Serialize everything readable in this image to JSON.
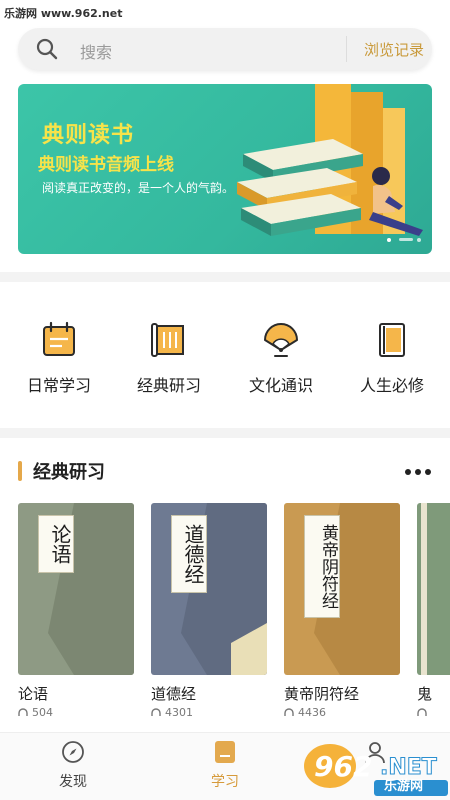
{
  "watermark_top": "乐游网 www.962.net",
  "search": {
    "placeholder": "搜索",
    "history_label": "浏览记录"
  },
  "banner": {
    "title": "典则读书",
    "subtitle": "典则读书音频上线",
    "description": "阅读真正改变的，是一个人的气韵。"
  },
  "categories": [
    {
      "label": "日常学习",
      "icon": "calendar-icon"
    },
    {
      "label": "经典研习",
      "icon": "scroll-icon"
    },
    {
      "label": "文化通识",
      "icon": "fan-icon"
    },
    {
      "label": "人生必修",
      "icon": "book-icon"
    }
  ],
  "section": {
    "title": "经典研习",
    "more_icon": "more-icon"
  },
  "books": [
    {
      "name": "论语",
      "listens": "504",
      "cover_title": "论语",
      "color": "#8e9a84"
    },
    {
      "name": "道德经",
      "listens": "4301",
      "cover_title": "道德经",
      "color": "#6e7a92"
    },
    {
      "name": "黄帝阴符经",
      "listens": "4436",
      "cover_title": "黄帝阴符经",
      "color": "#c99a52"
    },
    {
      "name": "鬼",
      "listens": "",
      "cover_title": "",
      "color": "#7f9a7a"
    }
  ],
  "tabs": [
    {
      "label": "发现",
      "icon": "compass-icon",
      "active": false
    },
    {
      "label": "学习",
      "icon": "study-icon",
      "active": true
    },
    {
      "label": "",
      "icon": "user-icon",
      "active": false
    }
  ],
  "watermark_logo": {
    "main": "962.NET",
    "sub": "乐游网"
  },
  "colors": {
    "accent": "#d69a3a",
    "banner_bg": "#3cc5a8",
    "banner_text": "#f7e34a"
  }
}
